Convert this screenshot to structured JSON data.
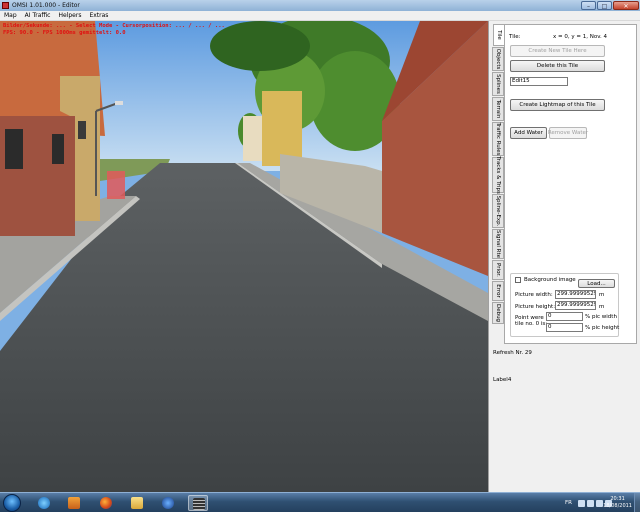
{
  "window": {
    "title": "OMSI 1.01.000 - Editor"
  },
  "menu": [
    "Map",
    "AI Traffic",
    "Helpers",
    "Extras"
  ],
  "viewport": {
    "overlay_line1": "Bilder/Sekunde: ... - Select Mode - Cursorposition: ... / ... / ...",
    "overlay_line2": "FPS: 90.0 - FPS 1000ms gemittelt: 0.0"
  },
  "tabs": [
    "Tile",
    "Objects",
    "Splines",
    "Terrain",
    "Traffic Rules",
    "Tracks & Trips",
    "Spline-Exp.",
    "Signal Rte",
    "Prior.",
    "Error",
    "Debug"
  ],
  "active_tab": "Tile",
  "tile_panel": {
    "tile_label": "Tile:",
    "tile_coords": "x = 0, y = 1, Nov. 4",
    "create_new_tile_here": "Create New Tile Here",
    "delete_this_tile": "Delete this Tile",
    "edit_value": "Edit15",
    "create_lightmap": "Create Lightmap of this Tile",
    "add_water": "Add Water",
    "remove_water": "Remove Water",
    "background_image_label": "Background image",
    "load_button": "Load...",
    "picture_width_label": "Picture width:",
    "picture_width_value": "299.999995292",
    "picture_width_unit": "m",
    "picture_height_label": "Picture height:",
    "picture_height_value": "299.999995292",
    "picture_height_unit": "m",
    "point_label_1": "Point were",
    "point_label_2": "tile no. 0 is:",
    "point_x_value": "0",
    "point_y_value": "0",
    "pic_width_label": "% pic width",
    "pic_height_label": "% pic height"
  },
  "status": {
    "refresh": "Refresh Nr. 29",
    "label4": "Label4"
  },
  "taskbar": {
    "lang": "FR",
    "time": "20:31",
    "date": "18/08/2011"
  }
}
